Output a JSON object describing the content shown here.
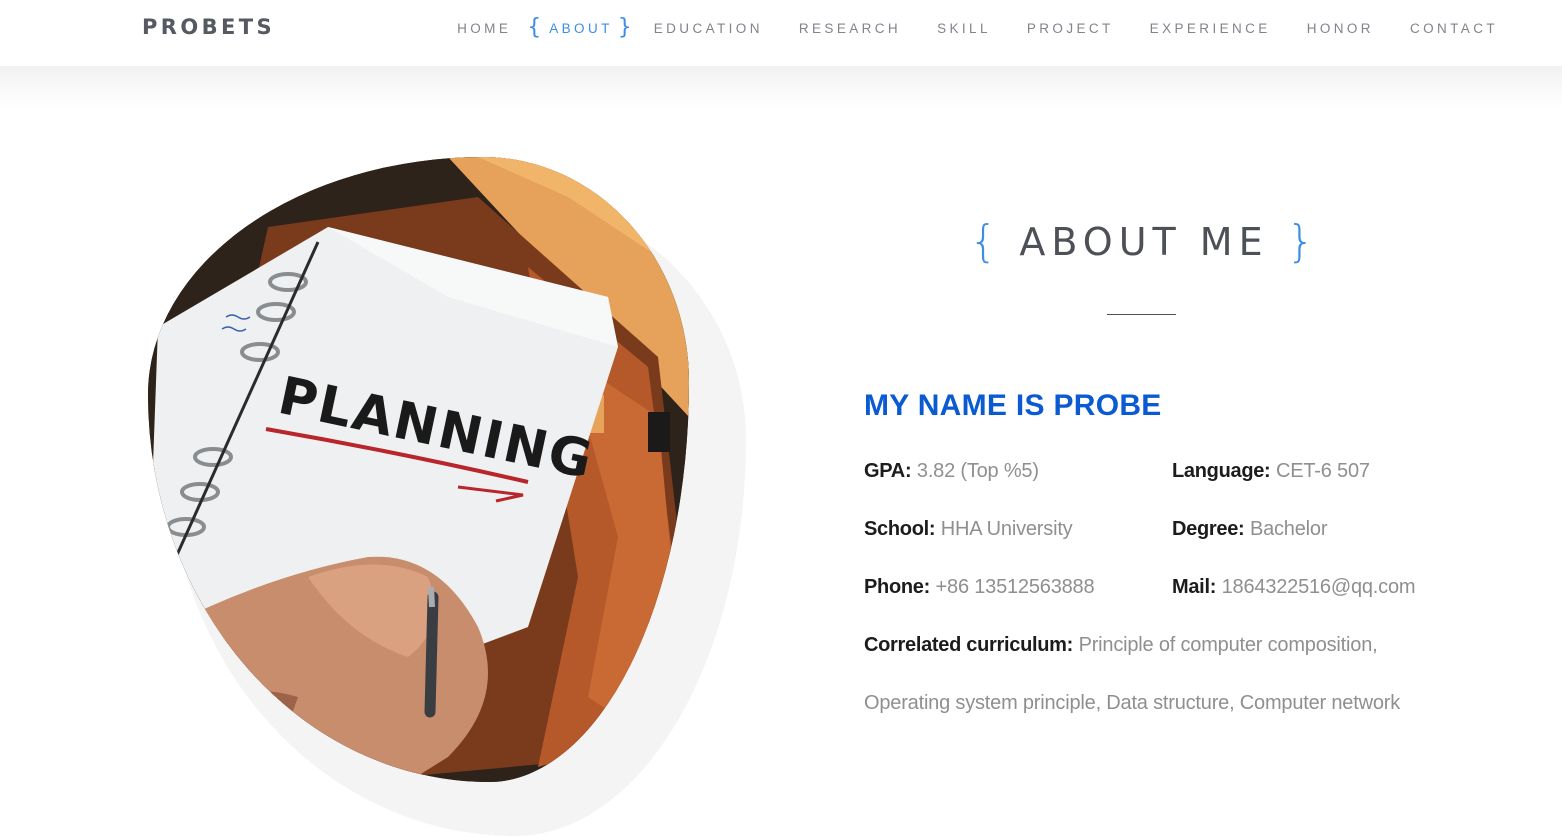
{
  "header": {
    "logo": "PROBETS",
    "nav": [
      {
        "label": "HOME",
        "active": false
      },
      {
        "label": "ABOUT",
        "active": true
      },
      {
        "label": "EDUCATION",
        "active": false
      },
      {
        "label": "RESEARCH",
        "active": false
      },
      {
        "label": "SKILL",
        "active": false
      },
      {
        "label": "PROJECT",
        "active": false
      },
      {
        "label": "EXPERIENCE",
        "active": false
      },
      {
        "label": "HONOR",
        "active": false
      },
      {
        "label": "CONTACT",
        "active": false
      }
    ],
    "brace_left": "{",
    "brace_right": "}"
  },
  "photo": {
    "notebook_text": "PLANNING"
  },
  "about": {
    "brace_left": "{",
    "brace_right": "}",
    "heading": "ABOUT ME",
    "name_title": "MY NAME IS PROBE",
    "gpa_label": "GPA:",
    "gpa_value": "3.82 (Top %5)",
    "language_label": "Language:",
    "language_value": "CET-6 507",
    "school_label": "School:",
    "school_value": "HHA University",
    "degree_label": "Degree:",
    "degree_value": "Bachelor",
    "phone_label": "Phone:",
    "phone_value": "+86 13512563888",
    "mail_label": "Mail:",
    "mail_value": "1864322516@qq.com",
    "curriculum_label": "Correlated curriculum:",
    "curriculum_value_line1": "Principle of computer composition,",
    "curriculum_value_line2": "Operating system principle, Data structure, Computer network"
  },
  "colors": {
    "accent": "#3b8ee5",
    "name_title": "#0a5bd1",
    "nav_text": "#80848b",
    "logo": "#555962",
    "value_text": "#8f8f8f"
  }
}
